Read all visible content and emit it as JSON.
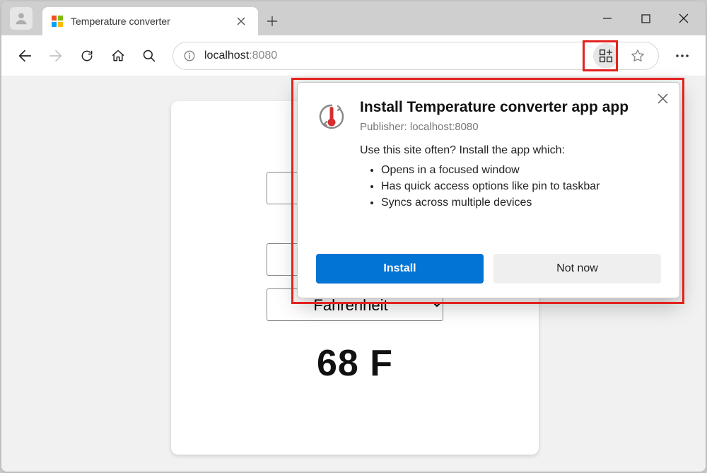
{
  "tab": {
    "title": "Temperature converter"
  },
  "address": {
    "host": "localhost",
    "port": ":8080"
  },
  "page": {
    "select_value": "Fahrenheit",
    "result": "68 F"
  },
  "install_popup": {
    "title": "Install Temperature converter app app",
    "publisher": "Publisher: localhost:8080",
    "lead": "Use this site often? Install the app which:",
    "bullets": {
      "0": "Opens in a focused window",
      "1": "Has quick access options like pin to taskbar",
      "2": "Syncs across multiple devices"
    },
    "install_label": "Install",
    "notnow_label": "Not now"
  }
}
